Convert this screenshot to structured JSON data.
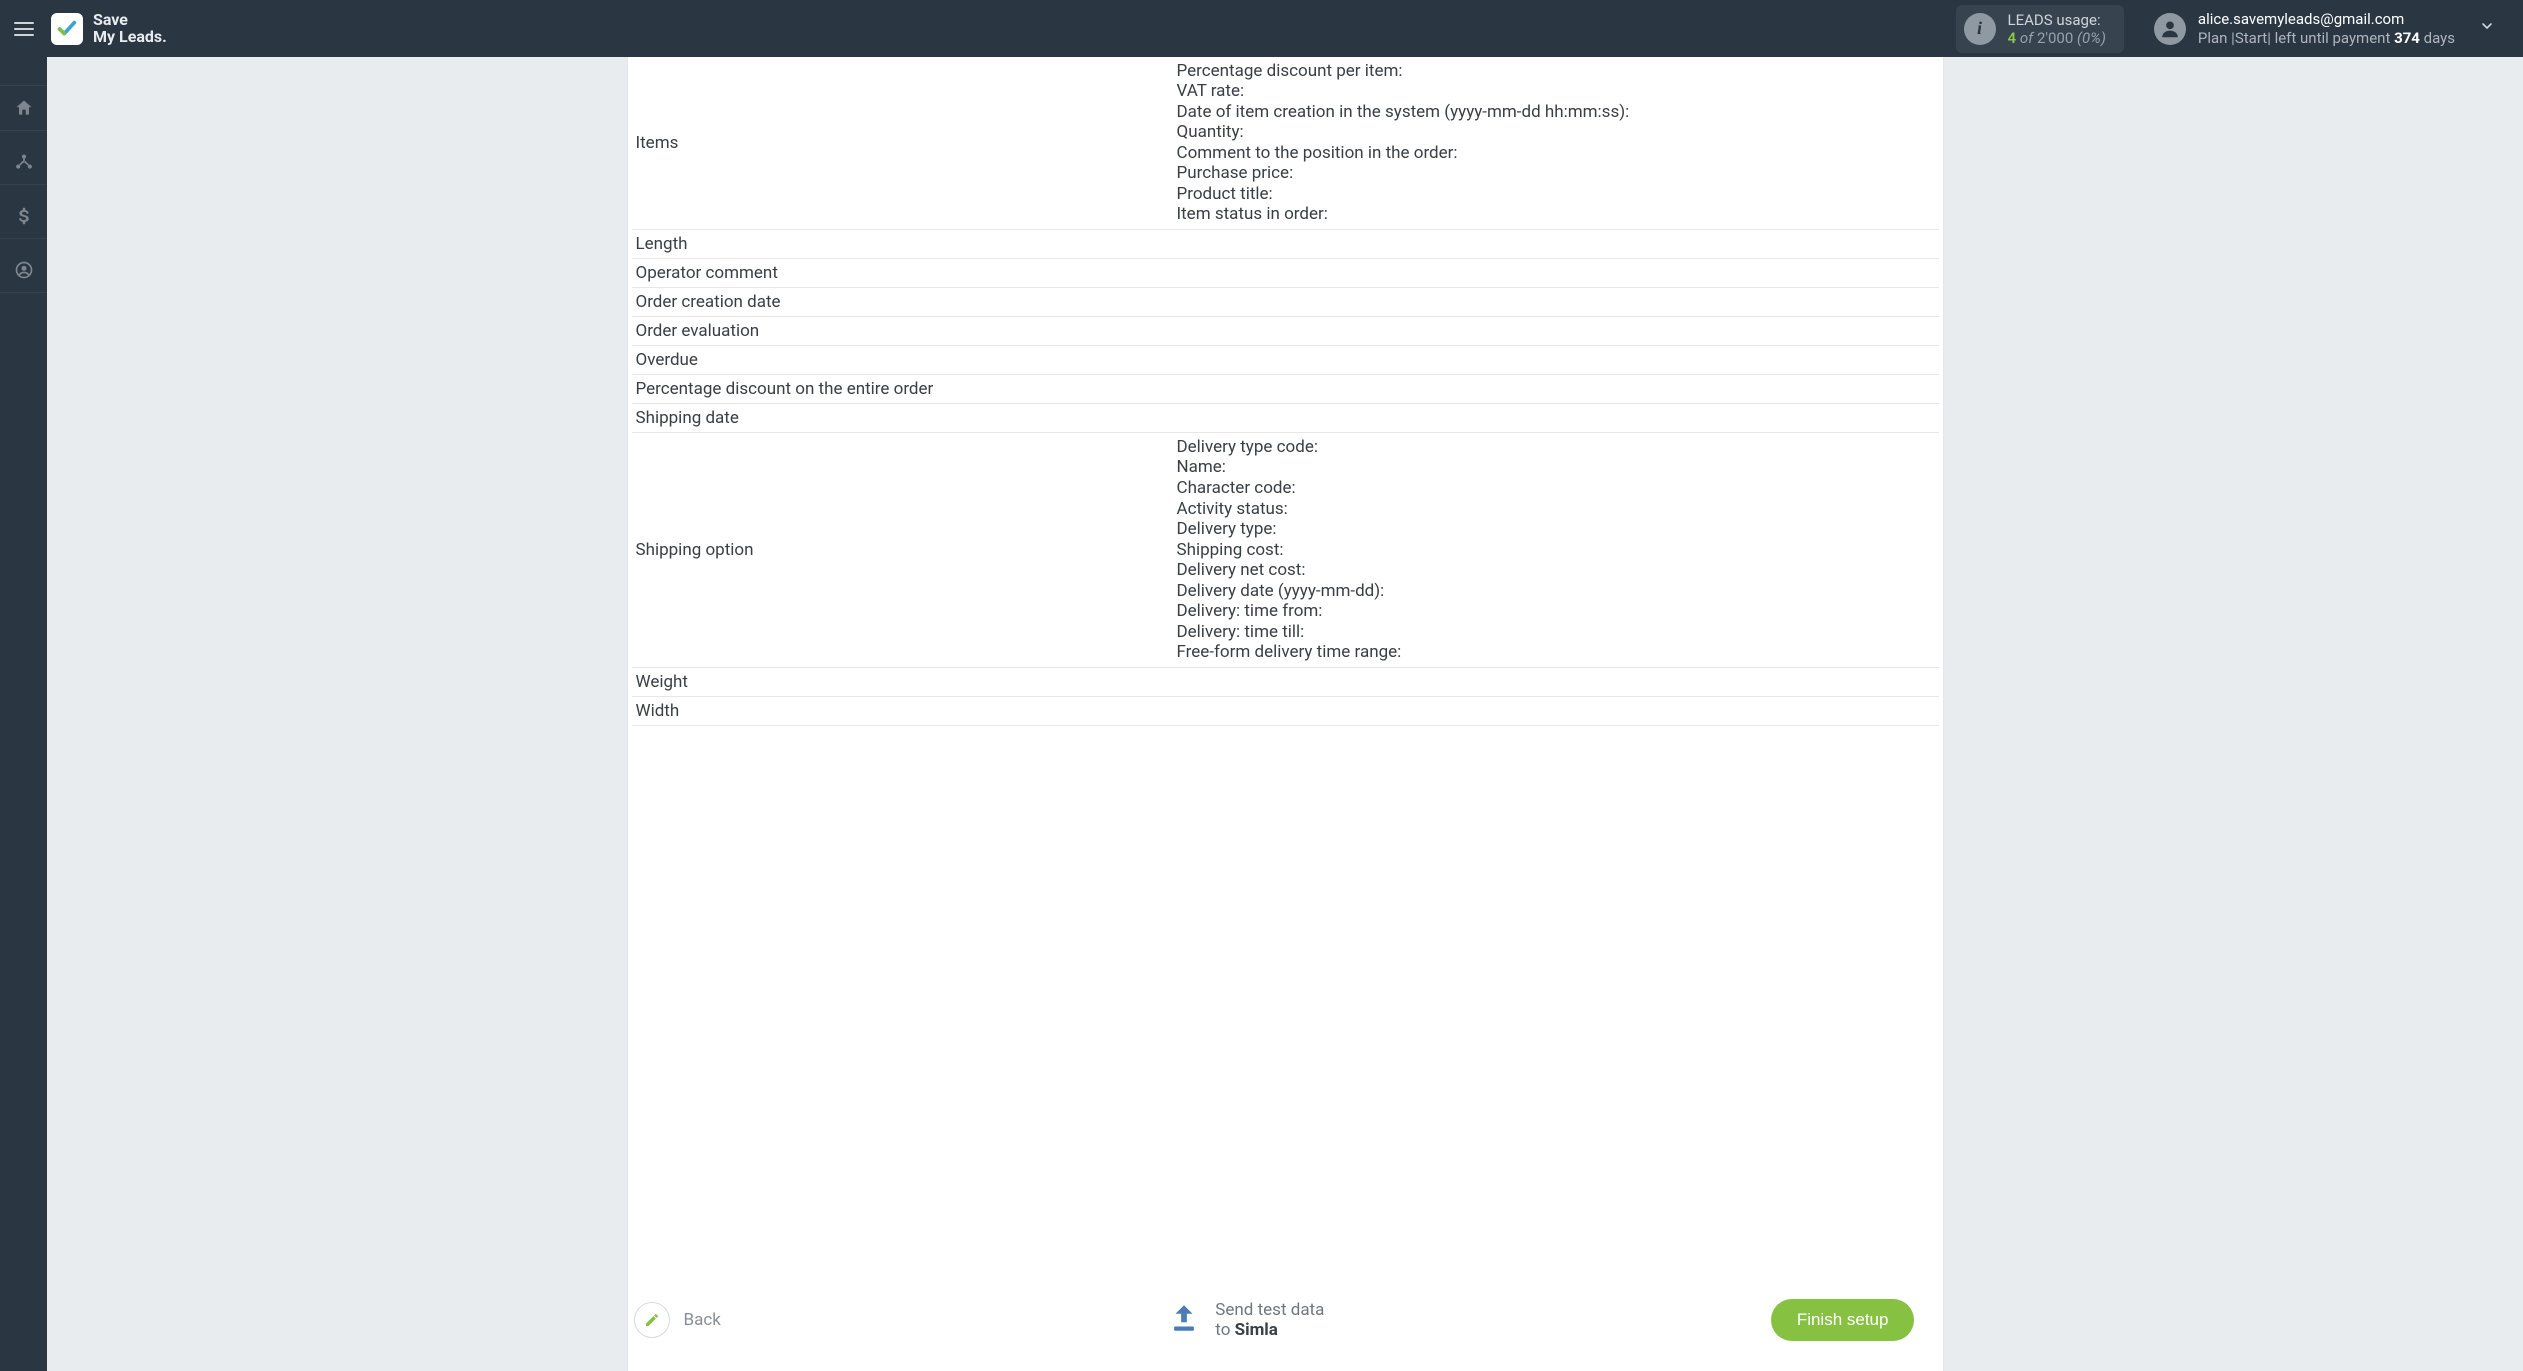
{
  "brand": {
    "line1": "Save",
    "line2": "My Leads."
  },
  "leads_usage": {
    "title": "LEADS usage:",
    "value": "4",
    "of": "of",
    "total": "2'000",
    "percent": "(0%)"
  },
  "account": {
    "email": "alice.savemyleads@gmail.com",
    "plan_prefix": "Plan |",
    "plan_name": "Start",
    "plan_sep": "| left until payment ",
    "days_value": "374",
    "days_suffix": " days"
  },
  "fields": [
    {
      "label": "Items",
      "values": [
        "Percentage discount per item:",
        "VAT rate:",
        "Date of item creation in the system (yyyy-mm-dd hh:mm:ss):",
        "Quantity:",
        "Comment to the position in the order:",
        "Purchase price:",
        "Product title:",
        "Item status in order:"
      ]
    },
    {
      "label": "Length",
      "values": []
    },
    {
      "label": "Operator comment",
      "values": []
    },
    {
      "label": "Order creation date",
      "values": []
    },
    {
      "label": "Order evaluation",
      "values": []
    },
    {
      "label": "Overdue",
      "values": []
    },
    {
      "label": "Percentage discount on the entire order",
      "values": []
    },
    {
      "label": "Shipping date",
      "values": []
    },
    {
      "label": "Shipping option",
      "values": [
        "Delivery type code:",
        "Name:",
        "Character code:",
        "Activity status:",
        "Delivery type:",
        "Shipping cost:",
        "Delivery net cost:",
        "Delivery date (yyyy-mm-dd):",
        "Delivery: time from:",
        "Delivery: time till:",
        "Free-form delivery time range:"
      ]
    },
    {
      "label": "Weight",
      "values": []
    },
    {
      "label": "Width",
      "values": []
    }
  ],
  "footer": {
    "back": "Back",
    "send_line1": "Send test data",
    "send_line2_prefix": "to ",
    "send_line2_target": "Simla",
    "finish": "Finish setup"
  }
}
